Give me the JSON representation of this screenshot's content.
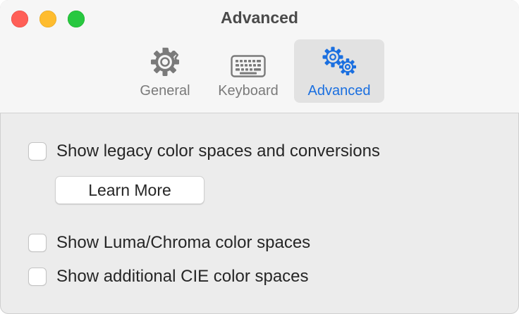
{
  "window": {
    "title": "Advanced",
    "controls": [
      "close",
      "minimize",
      "zoom"
    ]
  },
  "toolbar": {
    "tabs": [
      {
        "label": "General",
        "icon": "gear-icon",
        "selected": false
      },
      {
        "label": "Keyboard",
        "icon": "keyboard-icon",
        "selected": false
      },
      {
        "label": "Advanced",
        "icon": "gears-icon",
        "selected": true
      }
    ]
  },
  "options": {
    "legacy": {
      "label": "Show legacy color spaces and conversions",
      "checked": false
    },
    "learn_more_label": "Learn More",
    "luma": {
      "label": "Show Luma/Chroma color spaces",
      "checked": false
    },
    "cie": {
      "label": "Show additional CIE color spaces",
      "checked": false
    }
  },
  "colors": {
    "accent": "#1a6fe0",
    "close": "#ff5f57",
    "minimize": "#febc2e",
    "zoom": "#28c840"
  }
}
